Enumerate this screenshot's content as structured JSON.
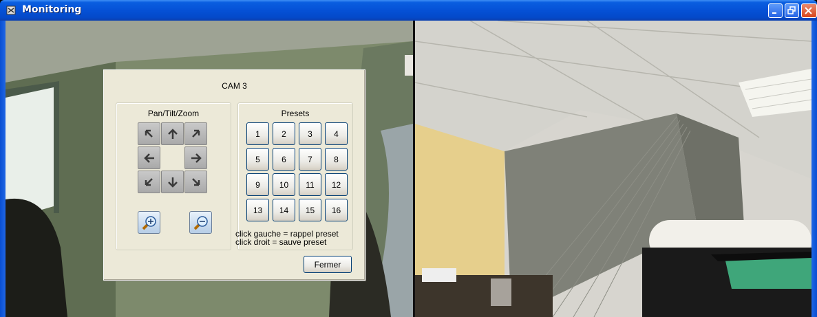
{
  "window": {
    "title": "Monitoring",
    "icons": [
      "app-icon",
      "minimize-icon",
      "restore-icon",
      "close-icon"
    ]
  },
  "ptz_dialog": {
    "title": "CAM 3",
    "pan_tilt_zoom": {
      "label": "Pan/Tilt/Zoom",
      "arrows": [
        "up-left-arrow-icon",
        "up-arrow-icon",
        "up-right-arrow-icon",
        "left-arrow-icon",
        "right-arrow-icon",
        "down-left-arrow-icon",
        "down-arrow-icon",
        "down-right-arrow-icon"
      ],
      "zoom": [
        "zoom-in-icon",
        "zoom-out-icon"
      ]
    },
    "presets": {
      "label": "Presets",
      "buttons": [
        "1",
        "2",
        "3",
        "4",
        "5",
        "6",
        "7",
        "8",
        "9",
        "10",
        "11",
        "12",
        "13",
        "14",
        "15",
        "16"
      ],
      "hint_left": "click gauche = rappel preset",
      "hint_right": "click droit = sauve preset"
    },
    "close_label": "Fermer"
  }
}
